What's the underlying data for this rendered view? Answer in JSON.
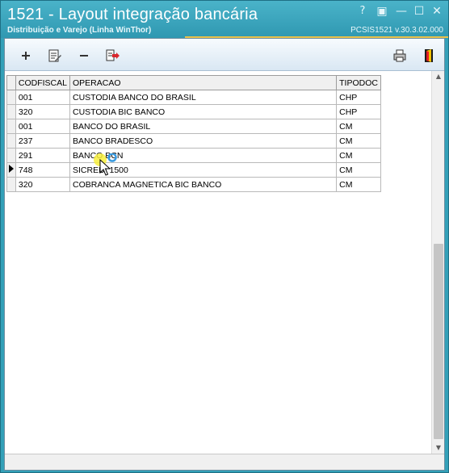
{
  "window": {
    "title": "1521 - Layout integração bancária",
    "subtitle": "Distribuição e Varejo (Linha WinThor)",
    "version": "PCSIS1521  v.30.3.02.000",
    "buttons": [
      "?",
      "▣",
      "—",
      "☐",
      "✕"
    ]
  },
  "toolbar": {
    "items": [
      {
        "name": "add-icon"
      },
      {
        "name": "edit-icon"
      },
      {
        "name": "remove-icon"
      },
      {
        "name": "export-icon"
      },
      {
        "name": "print-icon"
      },
      {
        "name": "exit-icon"
      }
    ]
  },
  "grid": {
    "columns": [
      "CODFISCAL",
      "OPERACAO",
      "TIPODOC"
    ],
    "rows": [
      {
        "codfiscal": "001",
        "operacao": "CUSTODIA BANCO DO BRASIL",
        "tipodoc": "CHP"
      },
      {
        "codfiscal": "320",
        "operacao": "CUSTODIA BIC BANCO",
        "tipodoc": "CHP"
      },
      {
        "codfiscal": "001",
        "operacao": "BANCO DO BRASIL",
        "tipodoc": "CM"
      },
      {
        "codfiscal": "237",
        "operacao": "BANCO BRADESCO",
        "tipodoc": "CM"
      },
      {
        "codfiscal": "291",
        "operacao": "BANCO BCN",
        "tipodoc": "CM"
      },
      {
        "codfiscal": "748",
        "operacao": "SICREDI 1500",
        "tipodoc": "CM"
      },
      {
        "codfiscal": "320",
        "operacao": "COBRANCA MAGNETICA BIC BANCO",
        "tipodoc": "CM"
      }
    ],
    "current_row_index": 5
  },
  "colors": {
    "titlebar": "#33a0b8",
    "accent": "#e9c24a",
    "toolbar": "#dbe8f4"
  }
}
